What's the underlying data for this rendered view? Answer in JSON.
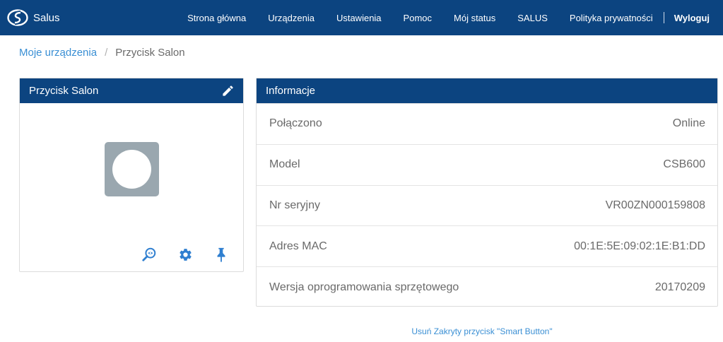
{
  "app": {
    "logo_text": "Salus"
  },
  "nav": {
    "items": [
      "Strona główna",
      "Urządzenia",
      "Ustawienia",
      "Pomoc",
      "Mój status",
      "SALUS",
      "Polityka prywatności"
    ],
    "logout": "Wyloguj"
  },
  "breadcrumb": {
    "parent": "Moje urządzenia",
    "separator": "/",
    "current": "Przycisk Salon"
  },
  "device": {
    "title": "Przycisk Salon",
    "icons": {
      "edit": "pencil-icon",
      "identify": "magnifier-eye-icon",
      "settings": "gear-icon",
      "pin": "pin-icon"
    }
  },
  "info": {
    "title": "Informacje",
    "rows": [
      {
        "label": "Połączono",
        "value": "Online"
      },
      {
        "label": "Model",
        "value": "CSB600"
      },
      {
        "label": "Nr seryjny",
        "value": "VR00ZN000159808"
      },
      {
        "label": "Adres MAC",
        "value": "00:1E:5E:09:02:1E:B1:DD"
      },
      {
        "label": "Wersja oprogramowania sprzętowego",
        "value": "20170209"
      }
    ]
  },
  "footer": {
    "remove_link": "Usuń Zakryty przycisk \"Smart Button\""
  },
  "colors": {
    "brand": "#0c4480",
    "link": "#3a8fd4",
    "icon": "#2f7fd0",
    "device_tile": "#9aa7af"
  }
}
